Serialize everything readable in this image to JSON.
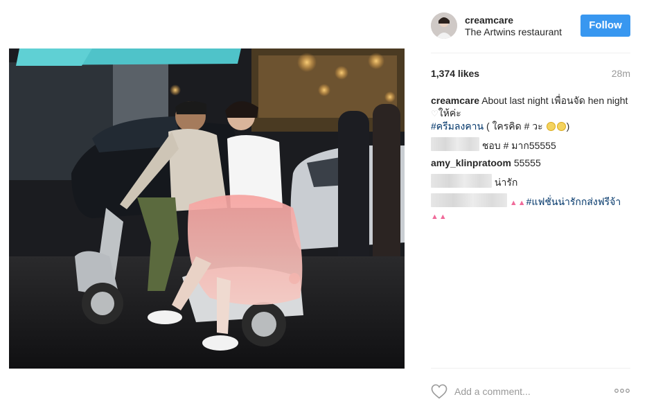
{
  "post": {
    "username": "creamcare",
    "location": "The Artwins restaurant",
    "follow_label": "Follow",
    "likes": "1,374 likes",
    "time": "28m",
    "image_alt": "Couple riding a scooter at night"
  },
  "comments": {
    "c1": {
      "user": "creamcare",
      "text_a": "About last night เพื่อนจัด hen night ",
      "text_b": "ให้ค่ะ",
      "hashtag": "#ครีมลงคาน",
      "text_c": " ( ใครคิด # วะ ",
      "text_d": ")"
    },
    "c2": {
      "text": "ชอบ # มาก55555"
    },
    "c3": {
      "user": "amy_klinpratoom",
      "text": "55555"
    },
    "c4": {
      "text": "น่ารัก"
    },
    "c5": {
      "hashtag": "#แฟชั่นน่ารักกส่งฟรีจ้า"
    }
  },
  "actions": {
    "comment_placeholder": "Add a comment..."
  },
  "icons": {
    "like": "heart-outline-icon",
    "more": "more-options-icon"
  },
  "colors": {
    "follow_button": "#3897f0",
    "hashtag": "#003569",
    "muted": "#999999"
  }
}
